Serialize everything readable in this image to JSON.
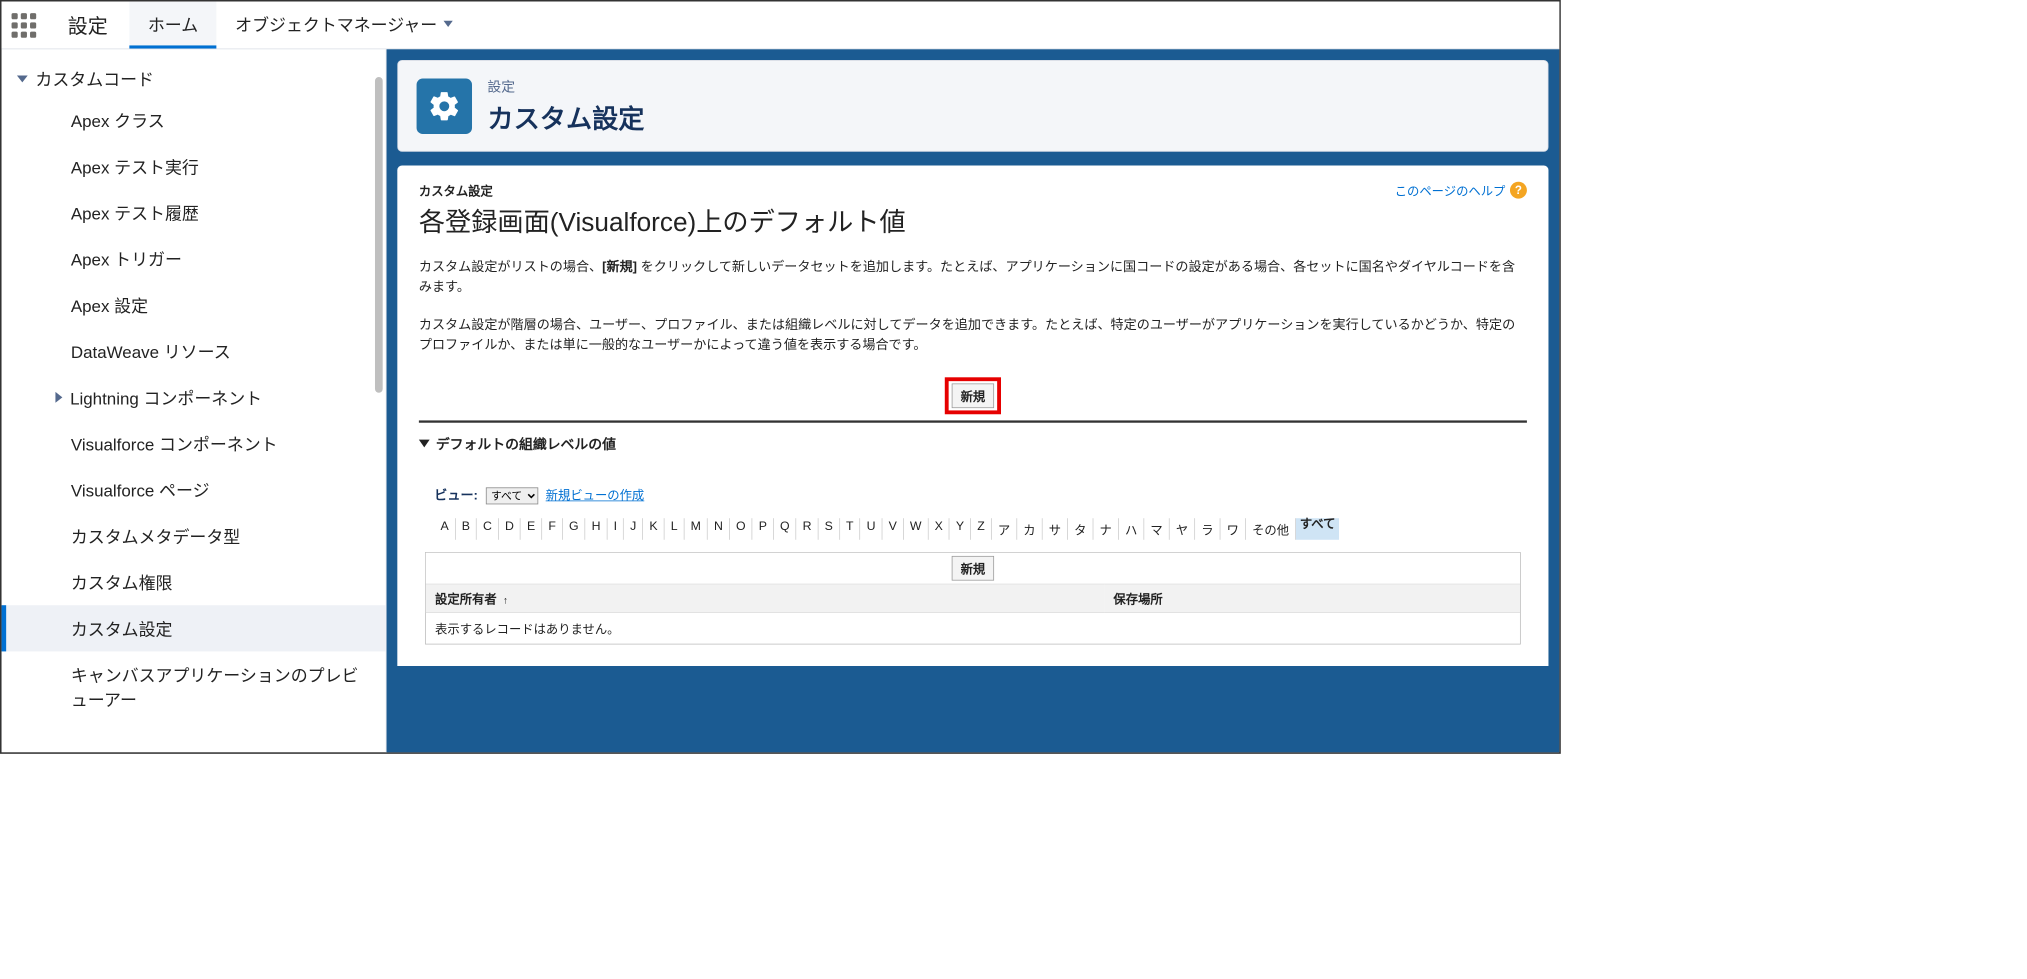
{
  "topnav": {
    "title": "設定",
    "tabs": [
      {
        "label": "ホーム",
        "active": true
      },
      {
        "label": "オブジェクトマネージャー",
        "active": false,
        "hasDropdown": true
      }
    ]
  },
  "sidebar": {
    "parentLabel": "カスタムコード",
    "items": [
      {
        "label": "Apex クラス"
      },
      {
        "label": "Apex テスト実行"
      },
      {
        "label": "Apex テスト履歴"
      },
      {
        "label": "Apex トリガー"
      },
      {
        "label": "Apex 設定"
      },
      {
        "label": "DataWeave リソース"
      },
      {
        "label": "Lightning コンポーネント",
        "isSubParent": true
      },
      {
        "label": "Visualforce コンポーネント"
      },
      {
        "label": "Visualforce ページ"
      },
      {
        "label": "カスタムメタデータ型"
      },
      {
        "label": "カスタム権限"
      },
      {
        "label": "カスタム設定",
        "active": true
      },
      {
        "label": "キャンバスアプリケーションのプレビューアー"
      }
    ]
  },
  "header": {
    "crumb": "設定",
    "title": "カスタム設定"
  },
  "page": {
    "supTitle": "カスタム設定",
    "mainTitle": "各登録画面(Visualforce)上のデフォルト値",
    "helpLabel": "このページのヘルプ",
    "desc1_a": "カスタム設定がリストの場合、",
    "desc1_bold": "[新規]",
    "desc1_b": " をクリックして新しいデータセットを追加します。たとえば、アプリケーションに国コードの設定がある場合、各セットに国名やダイヤルコードを含みます。",
    "desc2": "カスタム設定が階層の場合、ユーザー、プロファイル、または組織レベルに対してデータを追加できます。たとえば、特定のユーザーがアプリケーションを実行しているかどうか、特定のプロファイルか、または単に一般的なユーザーかによって違う値を表示する場合です。",
    "newButton": "新規",
    "sectionTitle": "デフォルトの組織レベルの値",
    "viewLabel": "ビュー:",
    "viewOption": "すべて",
    "viewCreate": "新規ビューの作成",
    "rolodex": [
      "A",
      "B",
      "C",
      "D",
      "E",
      "F",
      "G",
      "H",
      "I",
      "J",
      "K",
      "L",
      "M",
      "N",
      "O",
      "P",
      "Q",
      "R",
      "S",
      "T",
      "U",
      "V",
      "W",
      "X",
      "Y",
      "Z",
      "ア",
      "カ",
      "サ",
      "タ",
      "ナ",
      "ハ",
      "マ",
      "ヤ",
      "ラ",
      "ワ"
    ],
    "rolodexOther": "その他",
    "rolodexAll": "すべて",
    "table": {
      "newButton": "新規",
      "col1": "設定所有者",
      "col2": "保存場所",
      "emptyMsg": "表示するレコードはありません。"
    }
  }
}
